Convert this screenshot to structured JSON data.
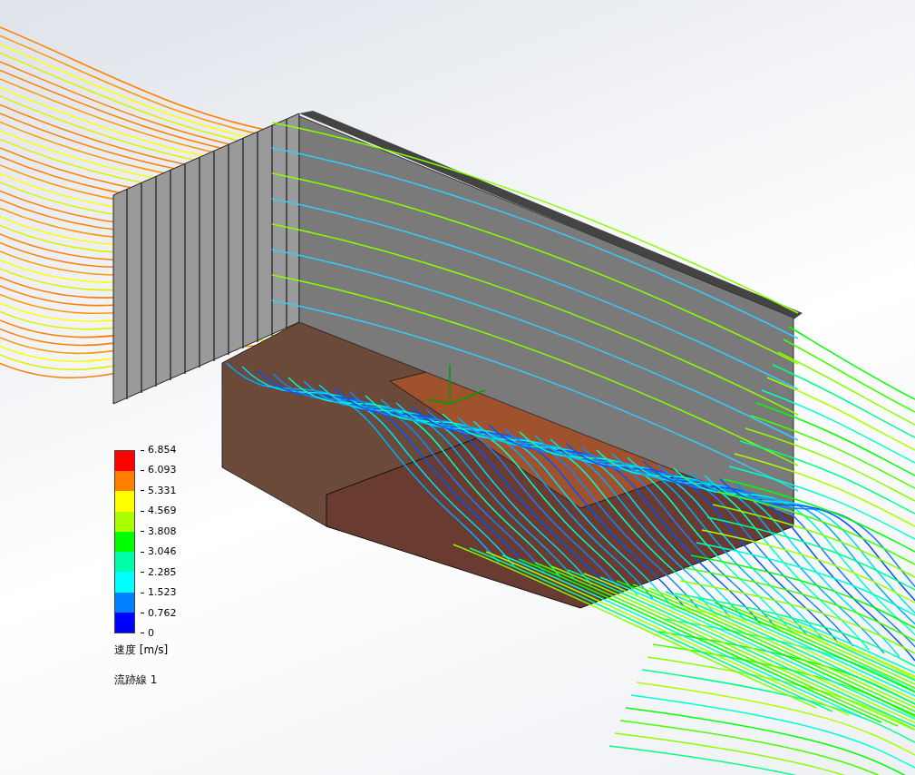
{
  "legend": {
    "bands": [
      {
        "color": "#ff0000"
      },
      {
        "color": "#ff8000"
      },
      {
        "color": "#ffff00"
      },
      {
        "color": "#aaff00"
      },
      {
        "color": "#00ff00"
      },
      {
        "color": "#00ffaa"
      },
      {
        "color": "#00ffff"
      },
      {
        "color": "#0080ff"
      },
      {
        "color": "#0000ff"
      }
    ],
    "ticks": [
      "6.854",
      "6.093",
      "5.331",
      "4.569",
      "3.808",
      "3.046",
      "2.285",
      "1.523",
      "0.762",
      "0"
    ],
    "quantity": "速度 [m/s]"
  },
  "plot_name": "流跡線 1"
}
